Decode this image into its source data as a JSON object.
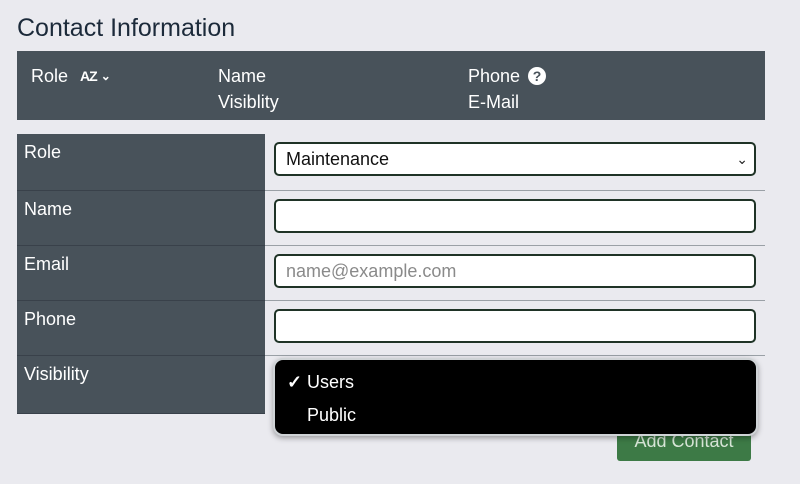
{
  "page": {
    "title": "Contact Information"
  },
  "table_header": {
    "role_label": "Role",
    "sort_az": "AZ",
    "sort_icon": "sort-az-icon",
    "chevron_icon": "chevron-down-icon",
    "name_label": "Name",
    "visibility_label": "Visiblity",
    "phone_label": "Phone",
    "help_icon": "question-circle-icon",
    "help_glyph": "?",
    "email_label": "E-Mail"
  },
  "form": {
    "role": {
      "label": "Role",
      "value": "Maintenance"
    },
    "name": {
      "label": "Name",
      "value": ""
    },
    "email": {
      "label": "Email",
      "value": "",
      "placeholder": "name@example.com"
    },
    "phone": {
      "label": "Phone",
      "value": ""
    },
    "visibility": {
      "label": "Visibility",
      "options": [
        {
          "label": "Users",
          "selected": true
        },
        {
          "label": "Public",
          "selected": false
        }
      ]
    }
  },
  "actions": {
    "add_contact_label": "Add Contact"
  },
  "colors": {
    "header_bg": "#48525a",
    "button_bg": "#3d7a46",
    "dropdown_bg": "#000000"
  }
}
